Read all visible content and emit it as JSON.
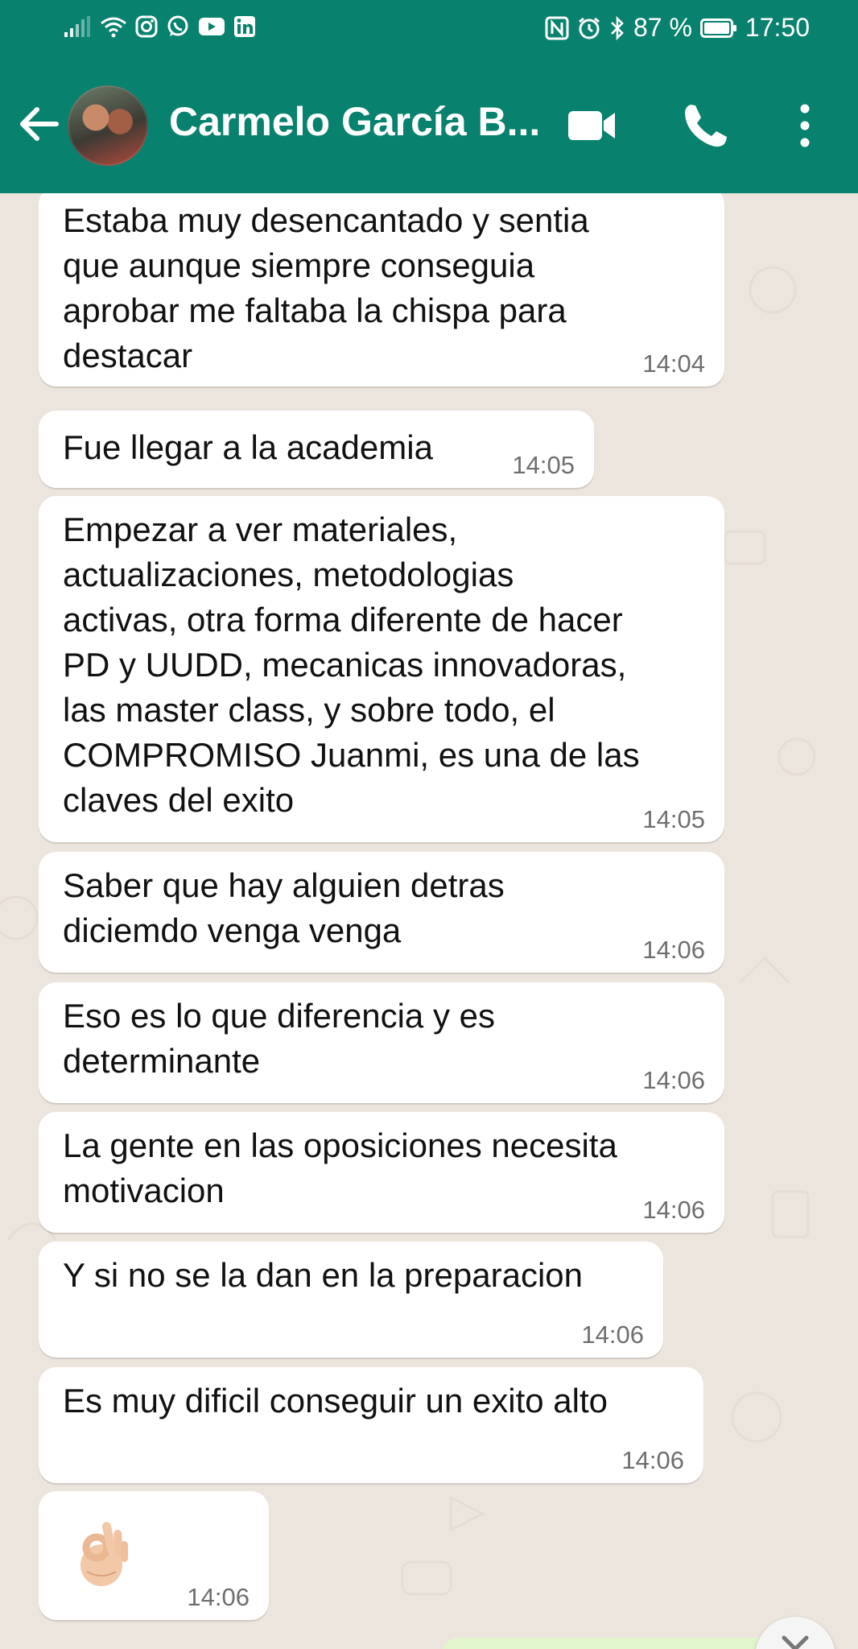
{
  "status_bar": {
    "battery": "87 %",
    "time": "17:50"
  },
  "header": {
    "contact_name": "Carmelo García B..."
  },
  "messages": [
    {
      "text": "Estaba muy desencantado y sentia\nque aunque siempre conseguia\naprobar me faltaba la chispa para\ndestacar",
      "time": "14:04"
    },
    {
      "text": "Fue llegar a la academia",
      "time": "14:05"
    },
    {
      "text": "Empezar a ver materiales,\nactualizaciones, metodologias\nactivas, otra forma diferente de hacer\nPD y UUDD, mecanicas innovadoras,\nlas master class, y sobre todo, el\nCOMPROMISO Juanmi, es una de las\nclaves del exito",
      "time": "14:05"
    },
    {
      "text": "Saber que hay alguien detras\ndiciemdo venga venga",
      "time": "14:06"
    },
    {
      "text": "Eso es lo que diferencia y es\ndeterminante",
      "time": "14:06"
    },
    {
      "text": "La gente en las oposiciones necesita\nmotivacion",
      "time": "14:06"
    },
    {
      "text": "Y si no se la dan en la preparacion",
      "time": "14:06"
    },
    {
      "text": "Es muy dificil conseguir un exito alto",
      "time": "14:06"
    },
    {
      "emoji": "ok-hand",
      "time": "14:06"
    }
  ],
  "colors": {
    "header": "#08826e",
    "chat_background": "#ece5dd",
    "incoming_bubble": "#ffffff",
    "outgoing_bubble": "#e1f6cb"
  },
  "icons": [
    "signal-icon",
    "wifi-icon",
    "instagram-icon",
    "whatsapp-icon",
    "youtube-icon",
    "linkedin-icon",
    "nfc-icon",
    "alarm-icon",
    "bluetooth-icon",
    "battery-icon",
    "back-arrow-icon",
    "video-call-icon",
    "phone-icon",
    "more-vert-icon",
    "chevron-down-icon"
  ]
}
